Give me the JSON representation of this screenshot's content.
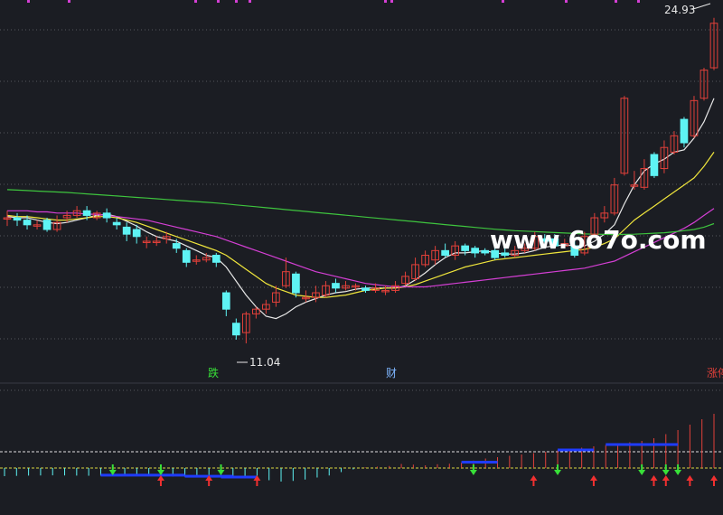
{
  "colors": {
    "background": "#1b1d23",
    "up": "#e2403a",
    "down": "#5ef3f4",
    "grid": "#56565e",
    "ma_short": "#e8e8e8",
    "ma_mid": "#f0e63c",
    "ma_long": "#d43fd4",
    "ma_longest": "#3ec43e",
    "watermark": "#ffffff",
    "marker_magenta": "#d43fd4",
    "bar_blue": "#1f3cff",
    "arrow_green": "#38e038",
    "arrow_red": "#f03030",
    "zero_line_yellow": "#d8d840",
    "ref_line_white": "#e0e0e0"
  },
  "watermark": "www.6o7o.com",
  "labels": {
    "high": "24.93",
    "low": "11.04",
    "die": "跌",
    "cai": "财",
    "zhangting": "涨停"
  },
  "chart_data": [
    {
      "type": "candlestick",
      "title": "",
      "ylim": [
        9.5,
        25.5
      ],
      "highest_marked": 24.93,
      "lowest_marked": 11.04,
      "grid": "dotted horizontal",
      "candles": [
        [
          16.4,
          16.4,
          16.7,
          16.05
        ],
        [
          16.4,
          16.3,
          16.6,
          16.05
        ],
        [
          16.3,
          16.1,
          16.5,
          15.9
        ],
        [
          16.1,
          16.1,
          16.3,
          15.9
        ],
        [
          16.3,
          15.9,
          16.4,
          15.8
        ],
        [
          15.9,
          16.2,
          16.5,
          15.8
        ],
        [
          16.4,
          16.5,
          16.7,
          16.2
        ],
        [
          16.5,
          16.7,
          16.9,
          16.4
        ],
        [
          16.7,
          16.5,
          16.9,
          16.3
        ],
        [
          16.4,
          16.6,
          16.7,
          16.3
        ],
        [
          16.6,
          16.4,
          16.8,
          16.2
        ],
        [
          16.2,
          16.1,
          16.4,
          15.9
        ],
        [
          16.0,
          15.7,
          16.2,
          15.4
        ],
        [
          15.9,
          15.6,
          16.1,
          15.3
        ],
        [
          15.4,
          15.4,
          15.6,
          15.1
        ],
        [
          15.4,
          15.4,
          15.6,
          15.2
        ],
        [
          15.5,
          15.6,
          15.8,
          15.3
        ],
        [
          15.3,
          15.1,
          15.5,
          14.9
        ],
        [
          15.0,
          14.5,
          15.1,
          14.3
        ],
        [
          14.6,
          14.6,
          14.8,
          14.4
        ],
        [
          14.6,
          14.7,
          14.9,
          14.5
        ],
        [
          14.8,
          14.5,
          14.9,
          14.3
        ],
        [
          13.2,
          12.5,
          13.3,
          12.2
        ],
        [
          11.9,
          11.4,
          12.1,
          11.2
        ],
        [
          11.5,
          12.3,
          12.4,
          11.04
        ],
        [
          12.3,
          12.5,
          12.6,
          12.1
        ],
        [
          12.5,
          12.7,
          12.9,
          12.3
        ],
        [
          12.8,
          13.2,
          13.5,
          12.6
        ],
        [
          13.5,
          14.1,
          14.7,
          13.4
        ],
        [
          14.0,
          13.2,
          14.1,
          13.0
        ],
        [
          13.0,
          13.0,
          13.3,
          12.8
        ],
        [
          13.0,
          13.2,
          13.5,
          12.8
        ],
        [
          13.1,
          13.5,
          13.7,
          13.0
        ],
        [
          13.6,
          13.4,
          13.8,
          13.2
        ],
        [
          13.4,
          13.5,
          13.7,
          13.3
        ],
        [
          13.5,
          13.5,
          13.6,
          13.3
        ],
        [
          13.4,
          13.3,
          13.5,
          13.2
        ],
        [
          13.3,
          13.4,
          13.6,
          13.2
        ],
        [
          13.3,
          13.3,
          13.5,
          13.1
        ],
        [
          13.3,
          13.5,
          13.7,
          13.2
        ],
        [
          13.6,
          13.9,
          14.1,
          13.5
        ],
        [
          13.8,
          14.4,
          14.7,
          13.7
        ],
        [
          14.4,
          14.8,
          15.0,
          14.3
        ],
        [
          14.6,
          15.0,
          15.2,
          14.4
        ],
        [
          15.0,
          14.8,
          15.3,
          14.7
        ],
        [
          14.8,
          15.2,
          15.4,
          14.6
        ],
        [
          15.2,
          15.0,
          15.3,
          14.8
        ],
        [
          15.1,
          14.9,
          15.2,
          14.7
        ],
        [
          15.0,
          14.9,
          15.1,
          14.8
        ],
        [
          15.0,
          14.7,
          15.1,
          14.6
        ],
        [
          14.9,
          14.8,
          15.1,
          14.7
        ],
        [
          14.8,
          15.0,
          15.2,
          14.7
        ],
        [
          15.0,
          15.1,
          15.3,
          14.9
        ],
        [
          15.1,
          15.6,
          15.8,
          15.0
        ],
        [
          15.5,
          15.4,
          15.7,
          15.2
        ],
        [
          15.5,
          15.2,
          15.7,
          15.1
        ],
        [
          15.2,
          15.3,
          15.5,
          15.1
        ],
        [
          15.2,
          14.8,
          15.4,
          14.7
        ],
        [
          14.9,
          15.6,
          15.8,
          14.8
        ],
        [
          15.7,
          16.4,
          16.6,
          15.6
        ],
        [
          16.4,
          16.6,
          16.9,
          16.2
        ],
        [
          16.6,
          17.8,
          18.1,
          16.5
        ],
        [
          18.3,
          21.5,
          21.6,
          18.2
        ],
        [
          17.8,
          17.8,
          18.4,
          17.6
        ],
        [
          17.7,
          18.5,
          18.9,
          17.6
        ],
        [
          19.1,
          18.2,
          19.2,
          18.1
        ],
        [
          18.5,
          19.4,
          19.7,
          18.3
        ],
        [
          19.2,
          19.9,
          20.1,
          19.1
        ],
        [
          20.6,
          19.6,
          20.7,
          19.4
        ],
        [
          19.9,
          21.4,
          21.6,
          19.8
        ],
        [
          21.5,
          22.7,
          22.8,
          21.4
        ],
        [
          22.8,
          24.7,
          24.93,
          22.7
        ]
      ],
      "ma_lines": [
        {
          "name": "MA5",
          "values": [
            16.45,
            16.4,
            16.4,
            16.3,
            16.2,
            16.15,
            16.2,
            16.3,
            16.4,
            16.5,
            16.55,
            16.45,
            16.25,
            16.05,
            15.8,
            15.6,
            15.5,
            15.4,
            15.2,
            15.0,
            14.8,
            14.7,
            14.3,
            13.7,
            13.1,
            12.6,
            12.2,
            12.1,
            12.3,
            12.6,
            12.8,
            12.95,
            13.1,
            13.2,
            13.25,
            13.35,
            13.4,
            13.4,
            13.4,
            13.4,
            13.5,
            13.75,
            14.05,
            14.4,
            14.7,
            14.9,
            14.9,
            14.95,
            15.0,
            14.9,
            14.85,
            14.85,
            14.9,
            15.0,
            15.15,
            15.2,
            15.25,
            15.2,
            15.2,
            15.4,
            15.7,
            16.1,
            17.0,
            17.8,
            18.4,
            18.7,
            18.9,
            19.2,
            19.3,
            19.8,
            20.5,
            21.5
          ]
        },
        {
          "name": "MA10",
          "values": [
            16.5,
            16.45,
            16.45,
            16.4,
            16.35,
            16.3,
            16.3,
            16.35,
            16.4,
            16.45,
            16.45,
            16.4,
            16.3,
            16.2,
            16.05,
            15.9,
            15.75,
            15.6,
            15.45,
            15.3,
            15.15,
            15.0,
            14.8,
            14.5,
            14.2,
            13.9,
            13.6,
            13.4,
            13.25,
            13.1,
            13.05,
            13.0,
            13.0,
            13.05,
            13.1,
            13.2,
            13.3,
            13.35,
            13.4,
            13.4,
            13.45,
            13.55,
            13.7,
            13.85,
            14.0,
            14.15,
            14.3,
            14.4,
            14.5,
            14.6,
            14.65,
            14.7,
            14.75,
            14.8,
            14.85,
            14.9,
            14.95,
            15.0,
            15.05,
            15.15,
            15.3,
            15.5,
            15.9,
            16.3,
            16.6,
            16.9,
            17.2,
            17.5,
            17.8,
            18.1,
            18.6,
            19.2
          ]
        },
        {
          "name": "MA30",
          "values": [
            16.7,
            16.7,
            16.7,
            16.65,
            16.65,
            16.6,
            16.6,
            16.6,
            16.55,
            16.55,
            16.5,
            16.45,
            16.4,
            16.35,
            16.3,
            16.2,
            16.1,
            16.0,
            15.9,
            15.8,
            15.7,
            15.6,
            15.45,
            15.3,
            15.15,
            15.0,
            14.85,
            14.7,
            14.55,
            14.4,
            14.25,
            14.1,
            14.0,
            13.9,
            13.8,
            13.7,
            13.6,
            13.55,
            13.5,
            13.45,
            13.45,
            13.45,
            13.45,
            13.5,
            13.55,
            13.6,
            13.65,
            13.7,
            13.75,
            13.8,
            13.85,
            13.9,
            13.95,
            14.0,
            14.05,
            14.1,
            14.15,
            14.2,
            14.25,
            14.35,
            14.45,
            14.55,
            14.75,
            14.95,
            15.15,
            15.35,
            15.55,
            15.75,
            15.95,
            16.2,
            16.5,
            16.8
          ]
        },
        {
          "name": "MA60",
          "values": [
            17.6,
            17.58,
            17.56,
            17.54,
            17.52,
            17.5,
            17.48,
            17.45,
            17.42,
            17.39,
            17.36,
            17.33,
            17.3,
            17.27,
            17.24,
            17.21,
            17.18,
            17.15,
            17.12,
            17.09,
            17.06,
            17.03,
            16.99,
            16.95,
            16.91,
            16.87,
            16.83,
            16.79,
            16.75,
            16.71,
            16.67,
            16.63,
            16.59,
            16.55,
            16.51,
            16.47,
            16.43,
            16.39,
            16.35,
            16.31,
            16.27,
            16.23,
            16.19,
            16.15,
            16.11,
            16.07,
            16.03,
            15.99,
            15.95,
            15.91,
            15.88,
            15.85,
            15.83,
            15.81,
            15.79,
            15.77,
            15.75,
            15.73,
            15.71,
            15.7,
            15.69,
            15.68,
            15.69,
            15.7,
            15.72,
            15.74,
            15.76,
            15.8,
            15.85,
            15.9,
            16.0,
            16.15
          ]
        }
      ]
    },
    {
      "type": "bar",
      "title": "",
      "indicator_values": [
        -0.6,
        -0.58,
        -0.56,
        -0.55,
        -0.54,
        -0.55,
        -0.56,
        -0.57,
        -0.56,
        -0.55,
        -0.55,
        -0.56,
        -0.58,
        -0.6,
        -0.62,
        -0.64,
        -0.66,
        -0.68,
        -0.7,
        -0.72,
        -0.75,
        -0.8,
        -0.9,
        -1.0,
        -0.95,
        -0.85,
        -0.7,
        -0.55,
        -0.3,
        -0.1,
        0.05,
        0.1,
        0.15,
        0.3,
        0.25,
        0.2,
        0.28,
        0.32,
        0.4,
        0.55,
        0.7,
        0.8,
        0.9,
        1.0,
        1.1,
        1.2,
        1.3,
        1.4,
        1.5,
        1.6,
        1.7,
        1.8,
        1.9,
        2.0,
        2.2,
        2.5,
        2.8,
        3.2,
        3.6,
        4.0
      ],
      "blue_bars": [
        [
          9,
          17
        ],
        [
          17,
          21
        ],
        [
          20,
          23
        ],
        [
          42,
          46
        ],
        [
          52,
          55
        ],
        [
          56,
          63
        ]
      ],
      "arrows": [
        {
          "dir": "down",
          "color": "green",
          "pos": 10
        },
        {
          "dir": "up",
          "color": "red",
          "pos": 14
        },
        {
          "dir": "down",
          "color": "green",
          "pos": 15
        },
        {
          "dir": "up",
          "color": "red",
          "pos": 19
        },
        {
          "dir": "down",
          "color": "green",
          "pos": 20
        },
        {
          "dir": "up",
          "color": "red",
          "pos": 24
        },
        {
          "dir": "down",
          "color": "green",
          "pos": 44
        },
        {
          "dir": "up",
          "color": "red",
          "pos": 49
        },
        {
          "dir": "down",
          "color": "green",
          "pos": 52
        },
        {
          "dir": "up",
          "color": "red",
          "pos": 55
        },
        {
          "dir": "down",
          "color": "green",
          "pos": 59
        },
        {
          "dir": "up",
          "color": "red",
          "pos": 60
        },
        {
          "dir": "down",
          "color": "green",
          "pos": 61
        },
        {
          "dir": "up",
          "color": "red",
          "pos": 62
        },
        {
          "dir": "down",
          "color": "green",
          "pos": 63
        },
        {
          "dir": "up",
          "color": "red",
          "pos": 64
        },
        {
          "dir": "up",
          "color": "red",
          "pos": 66
        }
      ]
    }
  ]
}
